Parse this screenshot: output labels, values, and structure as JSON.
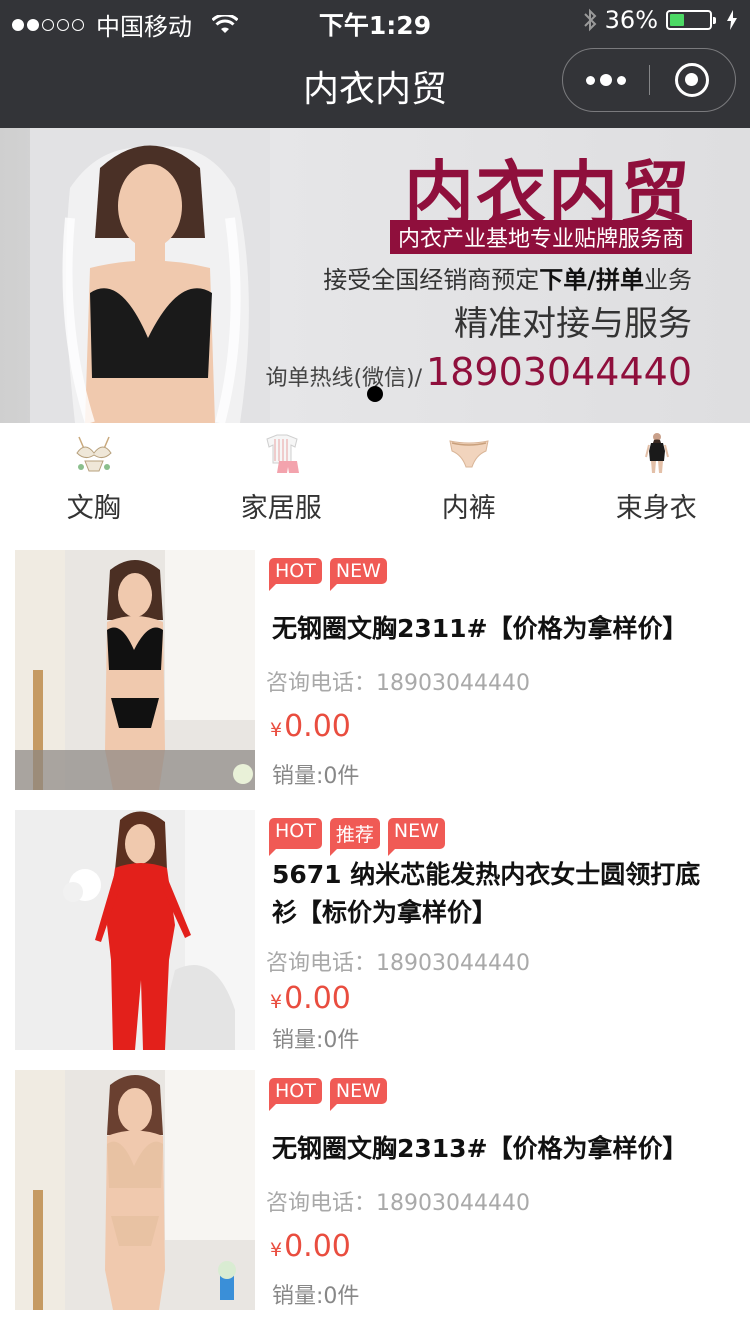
{
  "status_bar": {
    "carrier": "中国移动",
    "time": "下午1:29",
    "battery_percent": "36%",
    "battery_level": 0.36,
    "icons": [
      "signal-dots-icon",
      "wifi-icon",
      "bluetooth-icon",
      "battery-icon",
      "charging-icon"
    ]
  },
  "nav": {
    "title": "内衣内贸",
    "icons": [
      "more-dots-icon",
      "close-circle-icon"
    ]
  },
  "banner": {
    "title": "内衣内贸",
    "subtitle": "内衣产业基地专业贴牌服务商",
    "line1_prefix": "接受全国经销商预定",
    "line1_bold": "下单/拼单",
    "line1_suffix": "业务",
    "line2": "精准对接与服务",
    "hotline_label": "询单热线(微信)/",
    "hotline_number": "18903044440",
    "brand_color": "#8f0f3c"
  },
  "categories": [
    {
      "label": "文胸",
      "icon": "bra-icon"
    },
    {
      "label": "家居服",
      "icon": "loungewear-icon"
    },
    {
      "label": "内裤",
      "icon": "panties-icon"
    },
    {
      "label": "束身衣",
      "icon": "shapewear-icon"
    }
  ],
  "products": [
    {
      "tags": [
        "HOT",
        "NEW"
      ],
      "title": "无钢圈文胸2311#【价格为拿样价】",
      "phone": "咨询电话：18903044440",
      "currency": "¥",
      "price": "0.00",
      "sales": "销量:0件"
    },
    {
      "tags": [
        "HOT",
        "推荐",
        "NEW"
      ],
      "title": "5671 纳米芯能发热内衣女士圆领打底衫【标价为拿样价】",
      "phone": "咨询电话：18903044440",
      "currency": "¥",
      "price": "0.00",
      "sales": "销量:0件"
    },
    {
      "tags": [
        "HOT",
        "NEW"
      ],
      "title": "无钢圈文胸2313#【价格为拿样价】",
      "phone": "咨询电话：18903044440",
      "currency": "¥",
      "price": "0.00",
      "sales": "销量:0件"
    }
  ],
  "colors": {
    "nav_bg": "#333438",
    "tag": "#f05a55",
    "price": "#e94d3f",
    "muted_text": "#a9a9a9"
  }
}
